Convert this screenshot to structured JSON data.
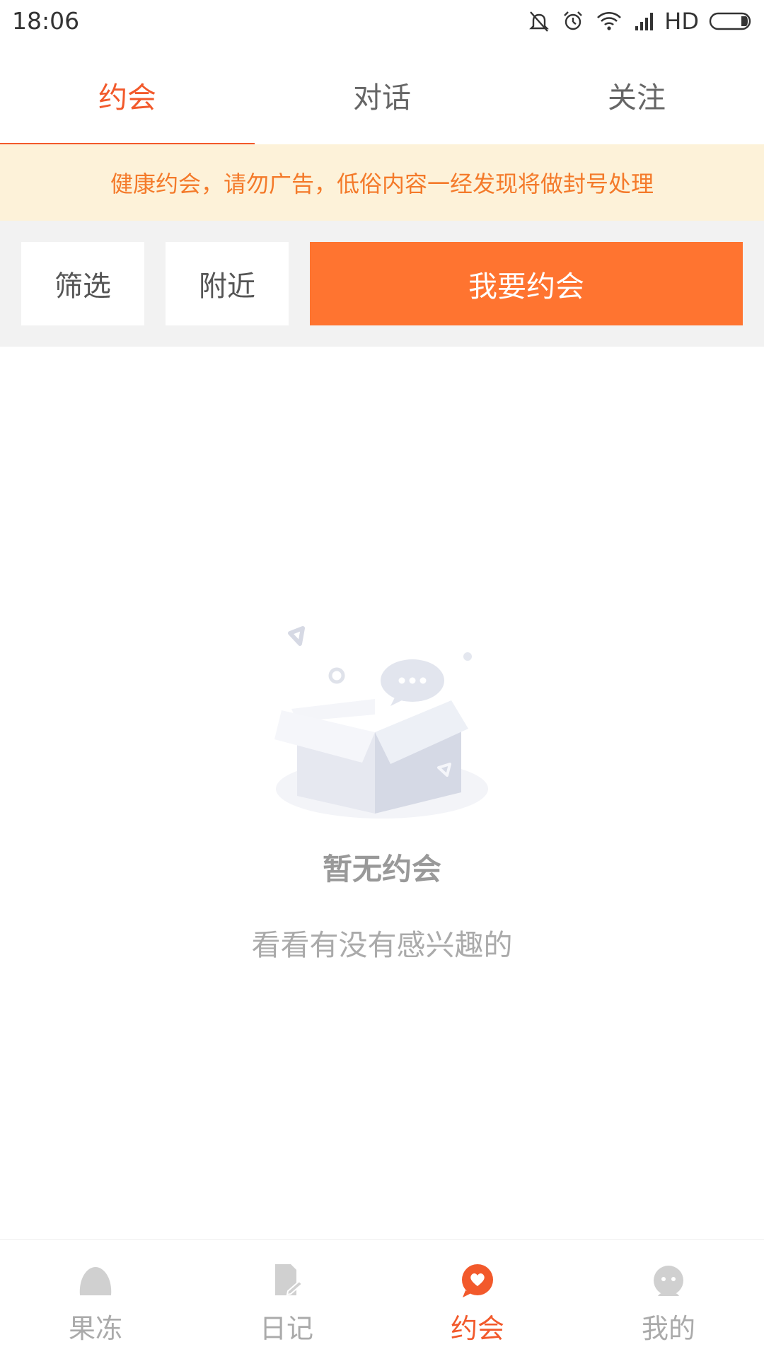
{
  "status_bar": {
    "time": "18:06",
    "network_label": "HD"
  },
  "tabs": [
    {
      "label": "约会",
      "active": true
    },
    {
      "label": "对话",
      "active": false
    },
    {
      "label": "关注",
      "active": false
    }
  ],
  "notice": {
    "text": "健康约会，请勿广告，低俗内容一经发现将做封号处理"
  },
  "filters": {
    "filter_label": "筛选",
    "nearby_label": "附近",
    "primary_label": "我要约会"
  },
  "empty_state": {
    "title": "暂无约会",
    "subtitle": "看看有没有感兴趣的"
  },
  "bottom_nav": [
    {
      "label": "果冻",
      "icon": "jelly-icon",
      "active": false
    },
    {
      "label": "日记",
      "icon": "diary-icon",
      "active": false
    },
    {
      "label": "约会",
      "icon": "heart-chat-icon",
      "active": true
    },
    {
      "label": "我的",
      "icon": "profile-icon",
      "active": false
    }
  ],
  "colors": {
    "accent": "#f2592b",
    "primary_button": "#ff7430",
    "notice_bg": "#fdf2d9",
    "notice_text": "#f47a2a"
  }
}
